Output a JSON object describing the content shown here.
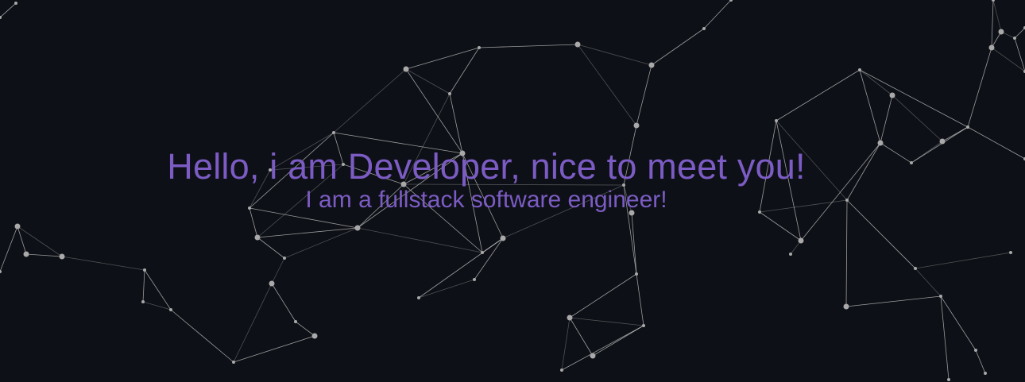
{
  "hero": {
    "headline": "Hello, i am Developer, nice to meet you!",
    "subtitle": "I am a fullstack software engineer!"
  },
  "colors": {
    "background": "#0d1016",
    "text_accent": "#7c5cc4",
    "network_line": "#c9c9c9",
    "network_node": "#a9a9a9"
  },
  "decoration": {
    "icon": "particle-network-background"
  }
}
